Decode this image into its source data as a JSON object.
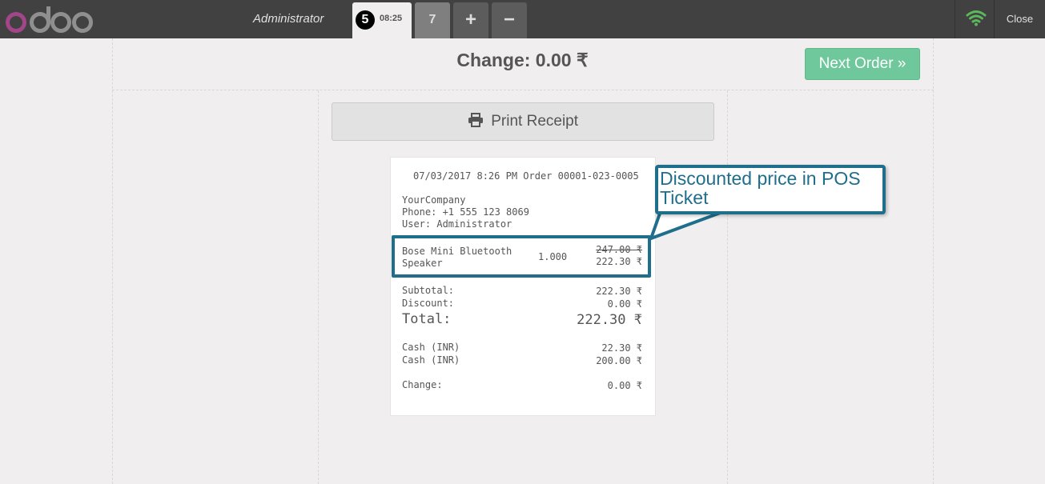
{
  "header": {
    "logo": "odoo",
    "cashier": "Administrator",
    "orders": {
      "active_number": "5",
      "active_time": "08:25",
      "second_number": "7"
    },
    "add_order": "+",
    "remove_order": "−",
    "network_icon": "wifi-icon",
    "close_label": "Close",
    "colors": {
      "bar": "#414141",
      "wifi": "#5cb85c",
      "logo_o": "#a24689",
      "logo_rest": "#8f8f8f"
    }
  },
  "screen": {
    "change_title": "Change: 0.00 ₹",
    "next_order_label": "Next Order",
    "print_label": "Print Receipt"
  },
  "receipt": {
    "header_line": "07/03/2017 8:26 PM Order 00001-023-0005",
    "company": "YourCompany",
    "phone": "Phone: +1 555 123 8069",
    "user": "User: Administrator",
    "line": {
      "name1": "Bose Mini Bluetooth",
      "name2": "Speaker",
      "qty": "1.000",
      "old_price": "247.00 ₹",
      "price": "222.30 ₹"
    },
    "subtotal_label": "Subtotal:",
    "subtotal": "222.30 ₹",
    "discount_label": "Discount:",
    "discount": "0.00 ₹",
    "total_label": "Total:",
    "total": "222.30 ₹",
    "payments": [
      {
        "label": "Cash (INR)",
        "amount": "22.30 ₹"
      },
      {
        "label": "Cash (INR)",
        "amount": "200.00 ₹"
      }
    ],
    "change_label": "Change:",
    "change": "0.00 ₹"
  },
  "annotation": {
    "line1": "Discounted price in POS",
    "line2": "Ticket",
    "color": "#1e6e8c"
  }
}
